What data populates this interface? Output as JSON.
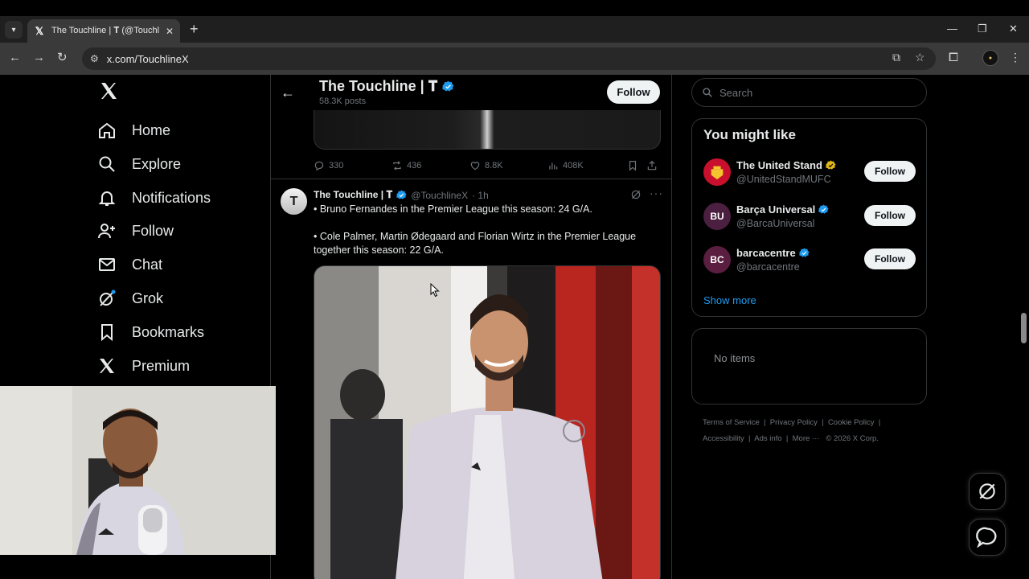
{
  "browser": {
    "tab_title": "The Touchline | 𝐓 (@TouchlineX",
    "url": "x.com/TouchlineX"
  },
  "nav": {
    "items": [
      {
        "label": "Home",
        "icon": "home-icon"
      },
      {
        "label": "Explore",
        "icon": "search-icon"
      },
      {
        "label": "Notifications",
        "icon": "bell-icon"
      },
      {
        "label": "Follow",
        "icon": "person-plus-icon"
      },
      {
        "label": "Chat",
        "icon": "mail-icon"
      },
      {
        "label": "Grok",
        "icon": "grok-icon"
      },
      {
        "label": "Bookmarks",
        "icon": "bookmark-icon"
      },
      {
        "label": "Premium",
        "icon": "x-logo-icon"
      }
    ]
  },
  "header": {
    "name": "The Touchline | 𝐓",
    "posts_count": "58.3K posts",
    "follow_label": "Follow"
  },
  "prev_tweet": {
    "replies": "330",
    "reposts": "436",
    "likes": "8.8K",
    "views": "408K"
  },
  "tweet": {
    "name": "The Touchline | 𝐓",
    "avatar_letter": "T",
    "handle": "@TouchlineX",
    "time": "· 1h",
    "line1": "• Bruno Fernandes in the Premier League this season: 24 G/A.",
    "line2": "• Cole Palmer, Martin Ødegaard and Florian Wirtz in the Premier League together this season: 22 G/A."
  },
  "search": {
    "placeholder": "Search"
  },
  "you_might_like": {
    "title": "You might like",
    "accounts": [
      {
        "name": "The United Stand",
        "handle": "@UnitedStandMUFC",
        "follow": "Follow",
        "badge": "gold",
        "avatar_text": "",
        "avatar_color": "#c8102e"
      },
      {
        "name": "Barça Universal",
        "handle": "@BarcaUniversal",
        "follow": "Follow",
        "badge": "blue",
        "avatar_text": "BU",
        "avatar_color": "#4a1f3f"
      },
      {
        "name": "barcacentre",
        "handle": "@barcacentre",
        "follow": "Follow",
        "badge": "blue",
        "avatar_text": "BC",
        "avatar_color": "#5a1e40"
      }
    ],
    "show_more": "Show more"
  },
  "empty_card": {
    "text": "No items"
  },
  "footer": {
    "terms": "Terms of Service",
    "privacy": "Privacy Policy",
    "cookie": "Cookie Policy",
    "accessibility": "Accessibility",
    "ads_info": "Ads info",
    "more": "More ···",
    "copyright": "© 2026 X Corp."
  },
  "colors": {
    "accent_blue": "#1d9bf0",
    "verified_gold": "#e2b719",
    "background": "#000000",
    "border": "#2f3336",
    "muted": "#71767b"
  }
}
